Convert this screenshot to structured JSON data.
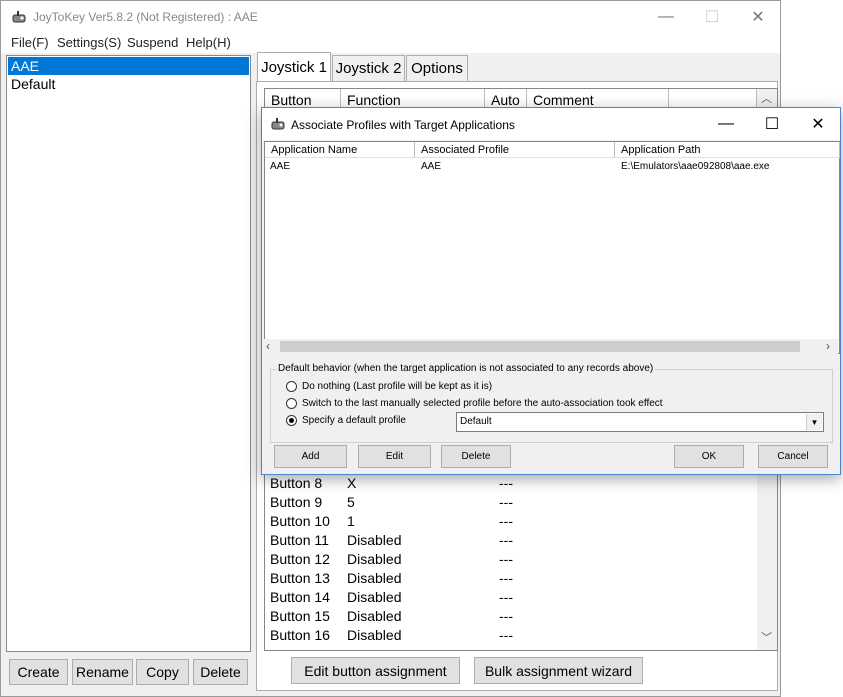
{
  "main_window": {
    "title": "JoyToKey Ver5.8.2 (Not Registered) : AAE",
    "menu": [
      "File(F)",
      "Settings(S)",
      "Suspend",
      "Help(H)"
    ]
  },
  "profiles": [
    {
      "name": "AAE",
      "selected": true
    },
    {
      "name": "Default",
      "selected": false
    }
  ],
  "profile_buttons": {
    "create": "Create",
    "rename": "Rename",
    "copy": "Copy",
    "delete": "Delete"
  },
  "tabs": [
    {
      "label": "Joystick 1",
      "active": true
    },
    {
      "label": "Joystick 2",
      "active": false
    },
    {
      "label": "Options",
      "active": false
    }
  ],
  "grid": {
    "headers": [
      "Button",
      "Function",
      "Auto",
      "Comment"
    ],
    "rows": [
      {
        "button": "Button 8",
        "function": "X",
        "auto": "---"
      },
      {
        "button": "Button 9",
        "function": "5",
        "auto": "---"
      },
      {
        "button": "Button 10",
        "function": "1",
        "auto": "---"
      },
      {
        "button": "Button 11",
        "function": "Disabled",
        "auto": "---"
      },
      {
        "button": "Button 12",
        "function": "Disabled",
        "auto": "---"
      },
      {
        "button": "Button 13",
        "function": "Disabled",
        "auto": "---"
      },
      {
        "button": "Button 14",
        "function": "Disabled",
        "auto": "---"
      },
      {
        "button": "Button 15",
        "function": "Disabled",
        "auto": "---"
      },
      {
        "button": "Button 16",
        "function": "Disabled",
        "auto": "---"
      }
    ]
  },
  "bottom_buttons": {
    "edit": "Edit button assignment",
    "bulk": "Bulk assignment wizard"
  },
  "dialog": {
    "title": "Associate Profiles with Target Applications",
    "columns": [
      "Application Name",
      "Associated Profile",
      "Application Path"
    ],
    "rows": [
      {
        "app": "AAE",
        "profile": "AAE",
        "path": "E:\\Emulators\\aae092808\\aae.exe"
      }
    ],
    "group_label": "Default behavior (when the target application is not associated to any records above)",
    "options": [
      {
        "label": "Do nothing (Last profile will be kept as it is)",
        "checked": false
      },
      {
        "label": "Switch to the last manually selected profile before the auto-association took effect",
        "checked": false
      },
      {
        "label": "Specify a default profile",
        "checked": true
      }
    ],
    "default_profile": "Default",
    "buttons": {
      "add": "Add",
      "edit": "Edit",
      "delete": "Delete",
      "ok": "OK",
      "cancel": "Cancel"
    }
  }
}
